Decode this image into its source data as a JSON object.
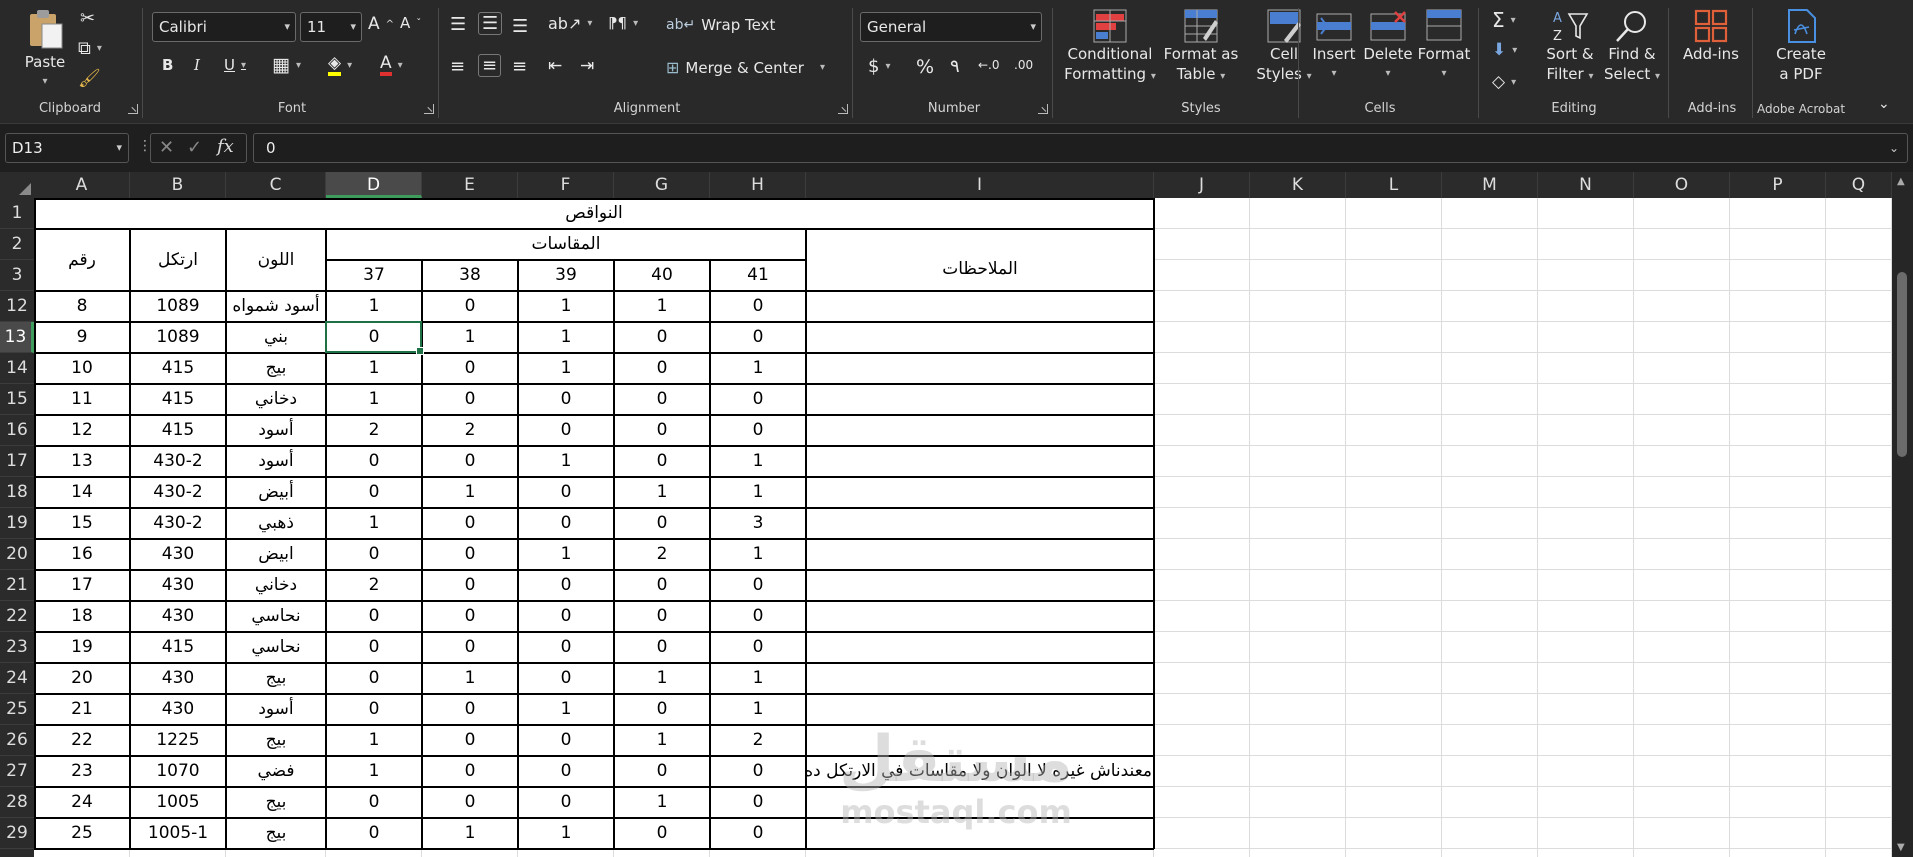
{
  "ribbon": {
    "clipboard": {
      "label": "Clipboard",
      "paste": "Paste"
    },
    "font": {
      "label": "Font",
      "name": "Calibri",
      "size": "11",
      "bold": "B",
      "italic": "I",
      "underline": "U"
    },
    "alignment": {
      "label": "Alignment",
      "wrap_text": "Wrap Text",
      "merge_center": "Merge & Center"
    },
    "number": {
      "label": "Number",
      "format": "General",
      "currency": "$",
      "percent": "%",
      "comma": "٩",
      "inc_decimal": "←.0",
      "dec_decimal": ".00"
    },
    "styles": {
      "label": "Styles",
      "conditional": [
        "Conditional",
        "Formatting"
      ],
      "format_table": [
        "Format as",
        "Table"
      ],
      "cell_styles": [
        "Cell",
        "Styles"
      ]
    },
    "cells": {
      "label": "Cells",
      "insert": "Insert",
      "delete": "Delete",
      "format": "Format"
    },
    "editing": {
      "label": "Editing",
      "sort_filter": [
        "Sort &",
        "Filter"
      ],
      "find_select": [
        "Find &",
        "Select"
      ]
    },
    "addins": {
      "label": "Add-ins",
      "addins_btn": "Add-ins"
    },
    "acrobat": {
      "label": "Adobe Acrobat",
      "create_pdf": [
        "Create",
        "a PDF"
      ]
    }
  },
  "formula_bar": {
    "name_box": "D13",
    "value": "0"
  },
  "columns": [
    "A",
    "B",
    "C",
    "D",
    "E",
    "F",
    "G",
    "H",
    "I",
    "J",
    "K",
    "L",
    "M",
    "N",
    "O",
    "P",
    "Q"
  ],
  "selected_column": "D",
  "rows": [
    "1",
    "2",
    "3",
    "12",
    "13",
    "14",
    "15",
    "16",
    "17",
    "18",
    "19",
    "20",
    "21",
    "22",
    "23",
    "24",
    "25",
    "26",
    "27",
    "28",
    "29"
  ],
  "selected_row": "13",
  "sheet": {
    "title": "النواقص",
    "headers": {
      "num": "رقم",
      "article": "ارتكل",
      "color": "اللون",
      "sizes": "المقاسات",
      "notes": "الملاحظات"
    },
    "sizes": [
      "37",
      "38",
      "39",
      "40",
      "41"
    ],
    "data_rows": [
      [
        "8",
        "1089",
        "أسود شمواه",
        "1",
        "0",
        "1",
        "1",
        "0",
        ""
      ],
      [
        "9",
        "1089",
        "بني",
        "0",
        "1",
        "1",
        "0",
        "0",
        ""
      ],
      [
        "10",
        "415",
        "بيج",
        "1",
        "0",
        "1",
        "0",
        "1",
        ""
      ],
      [
        "11",
        "415",
        "دخاني",
        "1",
        "0",
        "0",
        "0",
        "0",
        ""
      ],
      [
        "12",
        "415",
        "أسود",
        "2",
        "2",
        "0",
        "0",
        "0",
        ""
      ],
      [
        "13",
        "430-2",
        "أسود",
        "0",
        "0",
        "1",
        "0",
        "1",
        ""
      ],
      [
        "14",
        "430-2",
        "أبيض",
        "0",
        "1",
        "0",
        "1",
        "1",
        ""
      ],
      [
        "15",
        "430-2",
        "ذهبي",
        "1",
        "0",
        "0",
        "0",
        "3",
        ""
      ],
      [
        "16",
        "430",
        "ابيض",
        "0",
        "0",
        "1",
        "2",
        "1",
        ""
      ],
      [
        "17",
        "430",
        "دخاني",
        "2",
        "0",
        "0",
        "0",
        "0",
        ""
      ],
      [
        "18",
        "430",
        "نحاسي",
        "0",
        "0",
        "0",
        "0",
        "0",
        ""
      ],
      [
        "19",
        "415",
        "نحاسي",
        "0",
        "0",
        "0",
        "0",
        "0",
        ""
      ],
      [
        "20",
        "430",
        "بيج",
        "0",
        "1",
        "0",
        "1",
        "1",
        ""
      ],
      [
        "21",
        "430",
        "أسود",
        "0",
        "0",
        "1",
        "0",
        "1",
        ""
      ],
      [
        "22",
        "1225",
        "بيج",
        "1",
        "0",
        "0",
        "1",
        "2",
        ""
      ],
      [
        "23",
        "1070",
        "فضي",
        "1",
        "0",
        "0",
        "0",
        "0",
        "معندناش غيره لا الوان ولا مقاسات في الارتكل ده"
      ],
      [
        "24",
        "1005",
        "بيج",
        "0",
        "0",
        "0",
        "1",
        "0",
        ""
      ],
      [
        "25",
        "1005-1",
        "بيج",
        "0",
        "1",
        "1",
        "0",
        "0",
        ""
      ]
    ]
  },
  "watermark": {
    "logo": "مستقل",
    "site": "mostaql.com"
  }
}
